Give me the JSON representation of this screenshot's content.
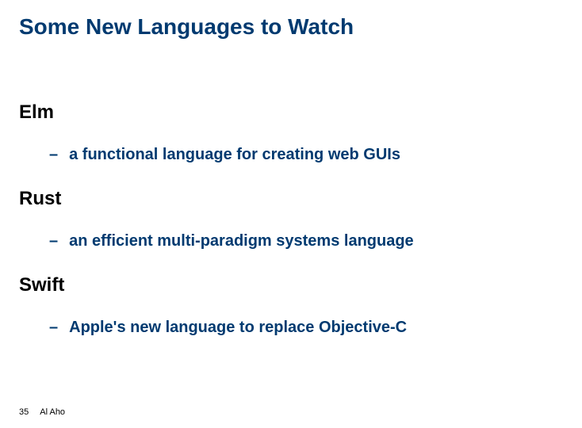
{
  "title": "Some New Languages to Watch",
  "sections": [
    {
      "heading": "Elm",
      "bullet": "a functional language for creating web GUIs"
    },
    {
      "heading": "Rust",
      "bullet": "an efficient multi-paradigm systems language"
    },
    {
      "heading": "Swift",
      "bullet": "Apple's new language to replace Objective-C"
    }
  ],
  "footer": {
    "page": "35",
    "author": "Al Aho"
  },
  "dash": "–"
}
